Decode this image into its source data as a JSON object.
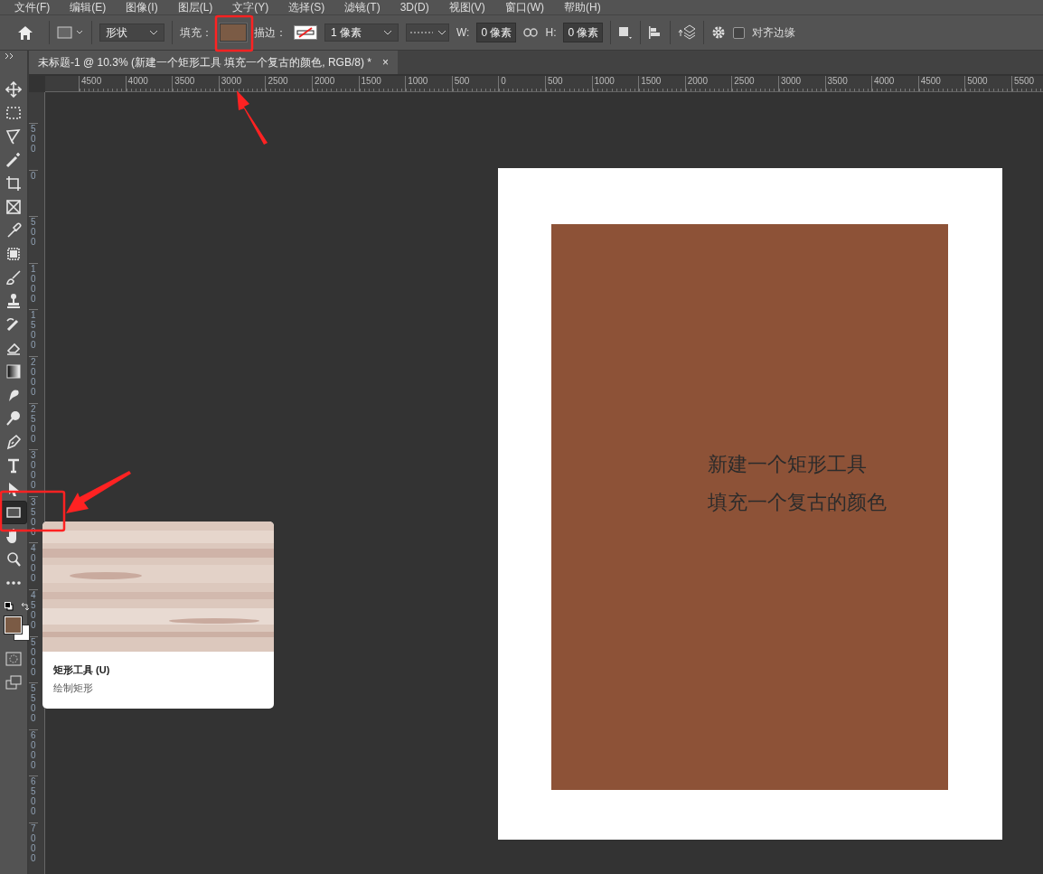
{
  "menu": [
    "文件(F)",
    "编辑(E)",
    "图像(I)",
    "图层(L)",
    "文字(Y)",
    "选择(S)",
    "滤镜(T)",
    "3D(D)",
    "视图(V)",
    "窗口(W)",
    "帮助(H)"
  ],
  "options_bar": {
    "tool_mode": "形状",
    "fill_label": "填充：",
    "stroke_label": "描边：",
    "stroke_width": "1 像素",
    "w_label": "W:",
    "w_value": "0 像素",
    "h_label": "H:",
    "h_value": "0 像素",
    "align_edges": {
      "label": "对齐边缘",
      "checked": false
    }
  },
  "document_tab": {
    "title": "未标题-1 @ 10.3% (新建一个矩形工具 填充一个复古的颜色, RGB/8) *",
    "close": "×"
  },
  "ruler": {
    "horizontal": [
      "4500",
      "4000",
      "3500",
      "3000",
      "2500",
      "2000",
      "1500",
      "1000",
      "500",
      "0",
      "500",
      "1000",
      "1500",
      "2000",
      "2500",
      "3000",
      "3500",
      "4000",
      "4500",
      "5000",
      "5500"
    ],
    "vertical": [
      "500",
      "0",
      "500",
      "1000",
      "1500",
      "2000",
      "2500",
      "3000",
      "3500",
      "4000",
      "4500",
      "5000",
      "5500",
      "6000",
      "6500",
      "7000"
    ]
  },
  "tools": [
    {
      "kind": "move",
      "selected": false
    },
    {
      "kind": "marquee",
      "selected": false
    },
    {
      "kind": "lasso",
      "selected": false
    },
    {
      "kind": "wand",
      "selected": false
    },
    {
      "kind": "crop",
      "selected": false
    },
    {
      "kind": "frame",
      "selected": false
    },
    {
      "kind": "eyedropper",
      "selected": false
    },
    {
      "kind": "patch",
      "selected": false
    },
    {
      "kind": "brush",
      "selected": false
    },
    {
      "kind": "stamp",
      "selected": false
    },
    {
      "kind": "history",
      "selected": false
    },
    {
      "kind": "eraser",
      "selected": false
    },
    {
      "kind": "gradient",
      "selected": false
    },
    {
      "kind": "smudge",
      "selected": false
    },
    {
      "kind": "dodge",
      "selected": false
    },
    {
      "kind": "pen",
      "selected": false
    },
    {
      "kind": "type",
      "selected": false
    },
    {
      "kind": "select",
      "selected": false
    },
    {
      "kind": "rectangle",
      "selected": true
    },
    {
      "kind": "hand",
      "selected": false
    },
    {
      "kind": "zoom",
      "selected": false
    },
    {
      "kind": "more",
      "selected": false
    }
  ],
  "tooltip": {
    "title": "矩形工具 (U)",
    "description": "绘制矩形"
  },
  "document": {
    "lines": [
      "新建一个矩形工具",
      "填充一个复古的颜色"
    ]
  }
}
